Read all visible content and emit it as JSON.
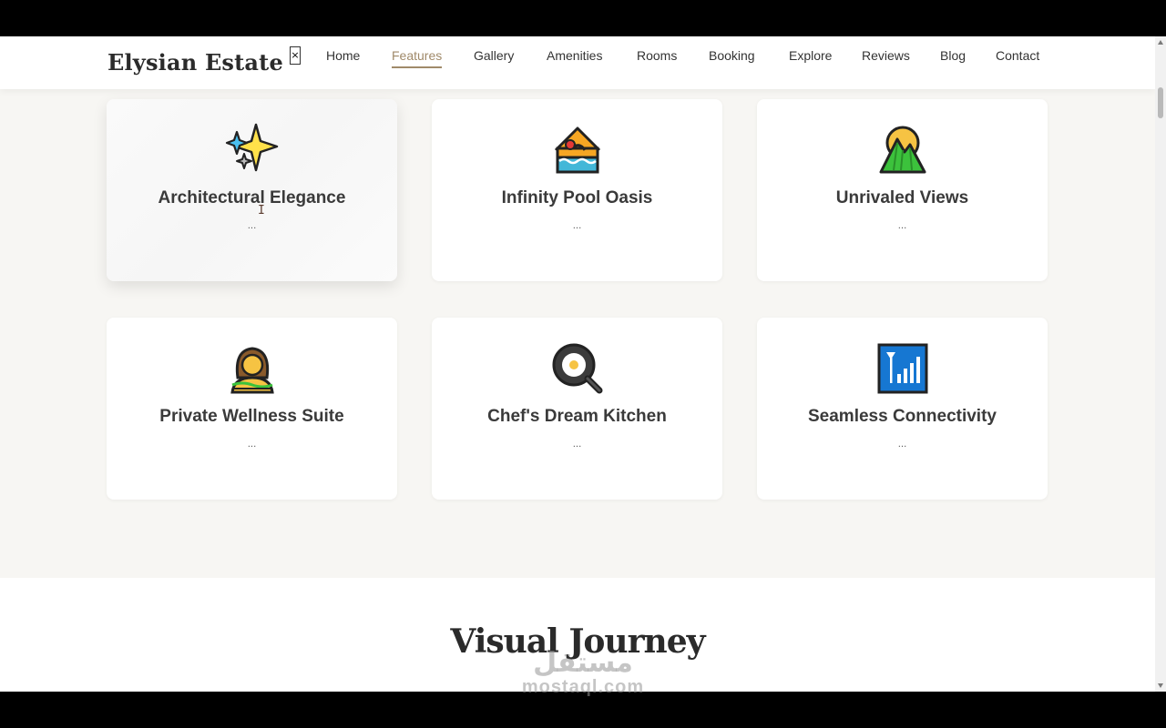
{
  "header": {
    "brand": "Elysian Estate",
    "close_label": "×",
    "nav": [
      {
        "label": "Home",
        "active": false
      },
      {
        "label": "Features",
        "active": true
      },
      {
        "label": "Gallery",
        "active": false
      },
      {
        "label": "Amenities",
        "active": false
      },
      {
        "label": "Rooms",
        "active": false
      },
      {
        "label": "Booking",
        "active": false
      },
      {
        "label": "Explore",
        "active": false
      },
      {
        "label": "Reviews",
        "active": false
      },
      {
        "label": "Blog",
        "active": false
      },
      {
        "label": "Contact",
        "active": false
      }
    ]
  },
  "features": {
    "cards": [
      {
        "icon": "sparkles-icon",
        "title": "Architectural Elegance",
        "desc": "..."
      },
      {
        "icon": "pool-swimmer-icon",
        "title": "Infinity Pool Oasis",
        "desc": "..."
      },
      {
        "icon": "mountain-sun-icon",
        "title": "Unrivaled Views",
        "desc": "..."
      },
      {
        "icon": "spa-person-icon",
        "title": "Private Wellness Suite",
        "desc": "..."
      },
      {
        "icon": "frying-pan-egg-icon",
        "title": "Chef's Dream Kitchen",
        "desc": "..."
      },
      {
        "icon": "antenna-bars-icon",
        "title": "Seamless Connectivity",
        "desc": "..."
      }
    ]
  },
  "gallery": {
    "title": "Visual Journey"
  },
  "watermark": {
    "arabic": "مستقل",
    "latin": "mostaql.com"
  },
  "colors": {
    "accent": "#a08a6a",
    "page_bg": "#f7f6f3",
    "card_bg": "#ffffff",
    "text": "#3a3a3a"
  }
}
